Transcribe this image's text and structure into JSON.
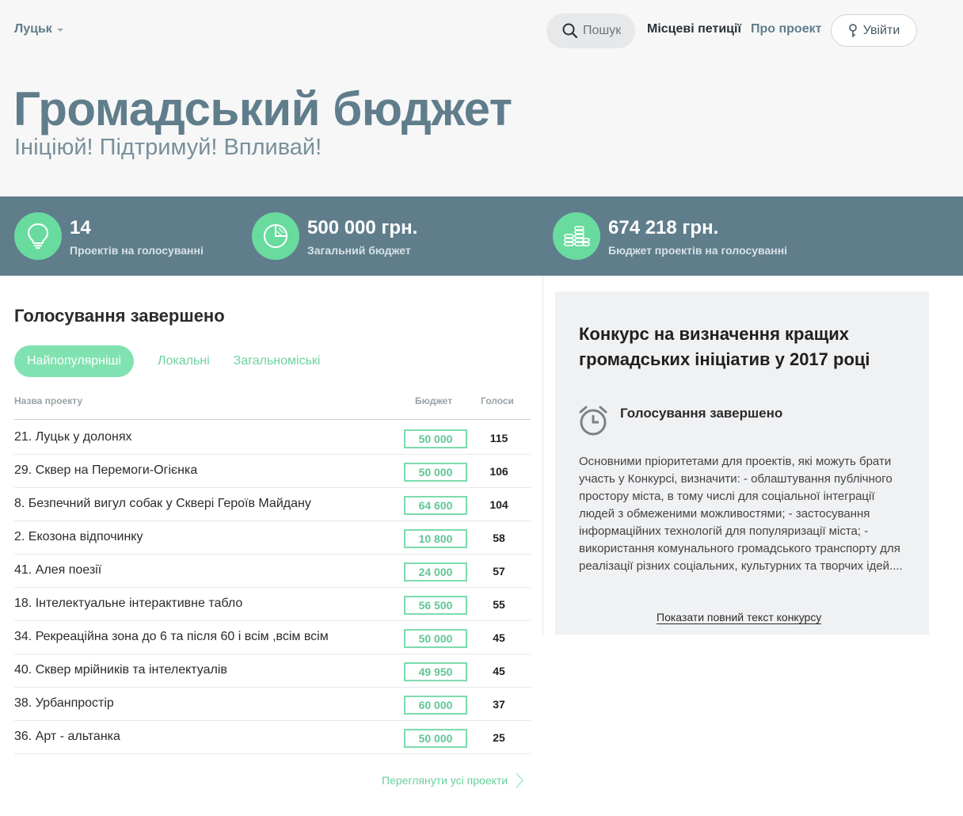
{
  "header": {
    "city": "Луцьк",
    "search_label": "Пошук",
    "nav_petitions": "Місцеві петиції",
    "nav_about": "Про проект",
    "login_label": "Увійти"
  },
  "hero": {
    "title": "Громадський бюджет",
    "subtitle": "Ініціюй! Підтримуй! Впливай!"
  },
  "stats": [
    {
      "value": "14",
      "label": "Проектів на голосуванні",
      "icon": "lightbulb-icon"
    },
    {
      "value": "500 000 грн.",
      "label": "Загальний бюджет",
      "icon": "pie-chart-icon"
    },
    {
      "value": "674 218 грн.",
      "label": "Бюджет проектів на голосуванні",
      "icon": "coins-icon"
    }
  ],
  "voting": {
    "title": "Голосування завершено",
    "tabs": [
      "Найпопулярніші",
      "Локальні",
      "Загальноміські"
    ],
    "active_tab": "Найпопулярніші",
    "columns": {
      "name": "Назва проекту",
      "budget": "Бюджет",
      "votes": "Голоси"
    },
    "rows": [
      {
        "name": "21. Луцьк у долонях",
        "budget": "50 000",
        "votes": "115"
      },
      {
        "name": "29. Сквер на Перемоги-Огієнка",
        "budget": "50 000",
        "votes": "106"
      },
      {
        "name": "8. Безпечний вигул собак у Сквері Героїв Майдану",
        "budget": "64 600",
        "votes": "104"
      },
      {
        "name": "2. Екозона відпочинку",
        "budget": "10 800",
        "votes": "58"
      },
      {
        "name": "41. Алея поезії",
        "budget": "24 000",
        "votes": "57"
      },
      {
        "name": "18. Інтелектуальне інтерактивне табло",
        "budget": "56 500",
        "votes": "55"
      },
      {
        "name": "34. Рекреаційна зона до 6 та після 60 і всім ,всім всім",
        "budget": "50 000",
        "votes": "45"
      },
      {
        "name": "40. Сквер мрійників та інтелектуалів",
        "budget": "49 950",
        "votes": "45"
      },
      {
        "name": "38. Урбанпростір",
        "budget": "60 000",
        "votes": "37"
      },
      {
        "name": "36. Арт - альтанка",
        "budget": "50 000",
        "votes": "25"
      }
    ],
    "all_projects_label": "Переглянути усі проекти"
  },
  "contest": {
    "title": "Конкурс на визначення кращих громадських ініціатив у 2017 році",
    "status": "Голосування завершено",
    "description": "Основними пріоритетами для проектів, які можуть брати участь у Конкурсі, визначити: - облаштування публічного простору міста, в тому числі для соціальної інтеграції людей з обмеженими можливостями; - застосування інформаційних технологій для популяризації міста; - використання комунального громадського транспорту для реалізації різних соціальних, культурних та творчих ідей....",
    "show_full_label": "Показати повний текст конкурсу"
  },
  "colors": {
    "accent_green": "#69db9f",
    "slate": "#607d8b",
    "panel_bg": "#f0f1f3"
  }
}
